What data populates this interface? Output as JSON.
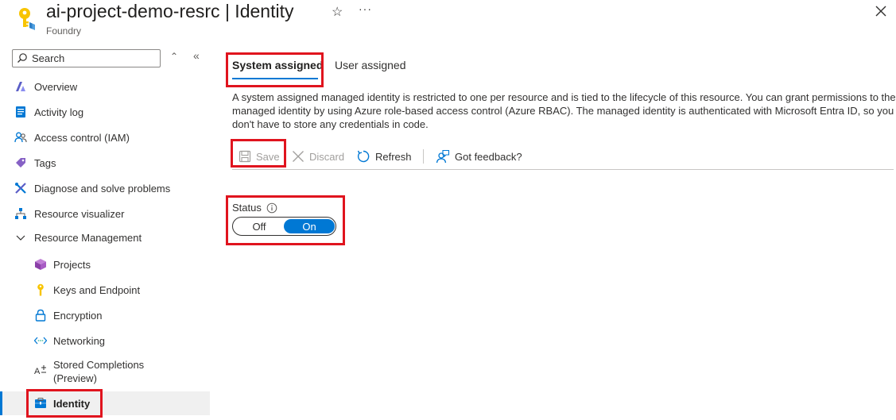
{
  "header": {
    "title": "ai-project-demo-resrc | Identity",
    "subtitle": "Foundry",
    "star_glyph": "☆",
    "more_glyph": "···",
    "resource_icon": "key-icon",
    "close_icon": "close-icon"
  },
  "sidebar": {
    "search_placeholder": "Search",
    "items": [
      {
        "label": "Overview",
        "icon": "foundry-logo-icon"
      },
      {
        "label": "Activity log",
        "icon": "activity-log-icon"
      },
      {
        "label": "Access control (IAM)",
        "icon": "people-icon"
      },
      {
        "label": "Tags",
        "icon": "tag-icon"
      },
      {
        "label": "Diagnose and solve problems",
        "icon": "wrench-icon"
      },
      {
        "label": "Resource visualizer",
        "icon": "hierarchy-icon"
      },
      {
        "label": "Resource Management",
        "icon": "chevron-down-icon"
      },
      {
        "label": "Projects",
        "icon": "cube-icon"
      },
      {
        "label": "Keys and Endpoint",
        "icon": "key-icon"
      },
      {
        "label": "Encryption",
        "icon": "lock-icon"
      },
      {
        "label": "Networking",
        "icon": "network-icon"
      },
      {
        "label": "Stored Completions",
        "label2": "(Preview)",
        "icon": "stored-completions-icon"
      },
      {
        "label": "Identity",
        "icon": "identity-icon"
      }
    ]
  },
  "main": {
    "tabs": [
      {
        "label": "System assigned",
        "selected": true
      },
      {
        "label": "User assigned",
        "selected": false
      }
    ],
    "description": "A system assigned managed identity is restricted to one per resource and is tied to the lifecycle of this resource. You can grant permissions to the managed identity by using Azure role-based access control (Azure RBAC). The managed identity is authenticated with Microsoft Entra ID, so you don't have to store any credentials in code.",
    "toolbar": {
      "save": "Save",
      "discard": "Discard",
      "refresh": "Refresh",
      "feedback": "Got feedback?"
    },
    "status": {
      "label": "Status",
      "off": "Off",
      "on": "On",
      "value": "On"
    }
  },
  "colors": {
    "accent": "#0078d4",
    "highlight": "#e0141e"
  }
}
